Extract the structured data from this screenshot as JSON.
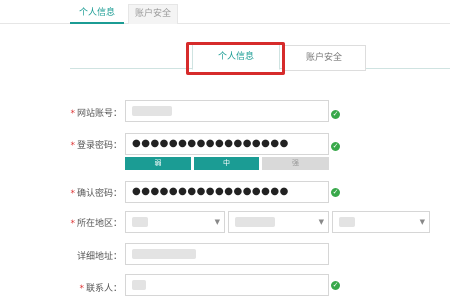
{
  "top_tabs": [
    {
      "label": "个人信息",
      "active": true
    },
    {
      "label": "账户安全",
      "active": false
    }
  ],
  "sub_tabs": [
    {
      "label": "个人信息",
      "active": true
    },
    {
      "label": "账户安全",
      "active": false
    }
  ],
  "form": {
    "account": {
      "label": "网站账号："
    },
    "password": {
      "label": "登录密码：",
      "value": "●●●●●●●●●●●●●●●●●"
    },
    "strength": {
      "weak": "弱",
      "medium": "中",
      "strong": "强"
    },
    "confirm": {
      "label": "确认密码：",
      "value": "●●●●●●●●●●●●●●●●●"
    },
    "region": {
      "label": "所在地区："
    },
    "address": {
      "label": "详细地址："
    },
    "contact": {
      "label": "联系人："
    }
  },
  "colors": {
    "accent": "#1b9c94",
    "highlight": "#d62b2b",
    "ok": "#38a84a"
  },
  "icons": {
    "check": "check-circle-icon",
    "caret": "chevron-down-icon"
  }
}
